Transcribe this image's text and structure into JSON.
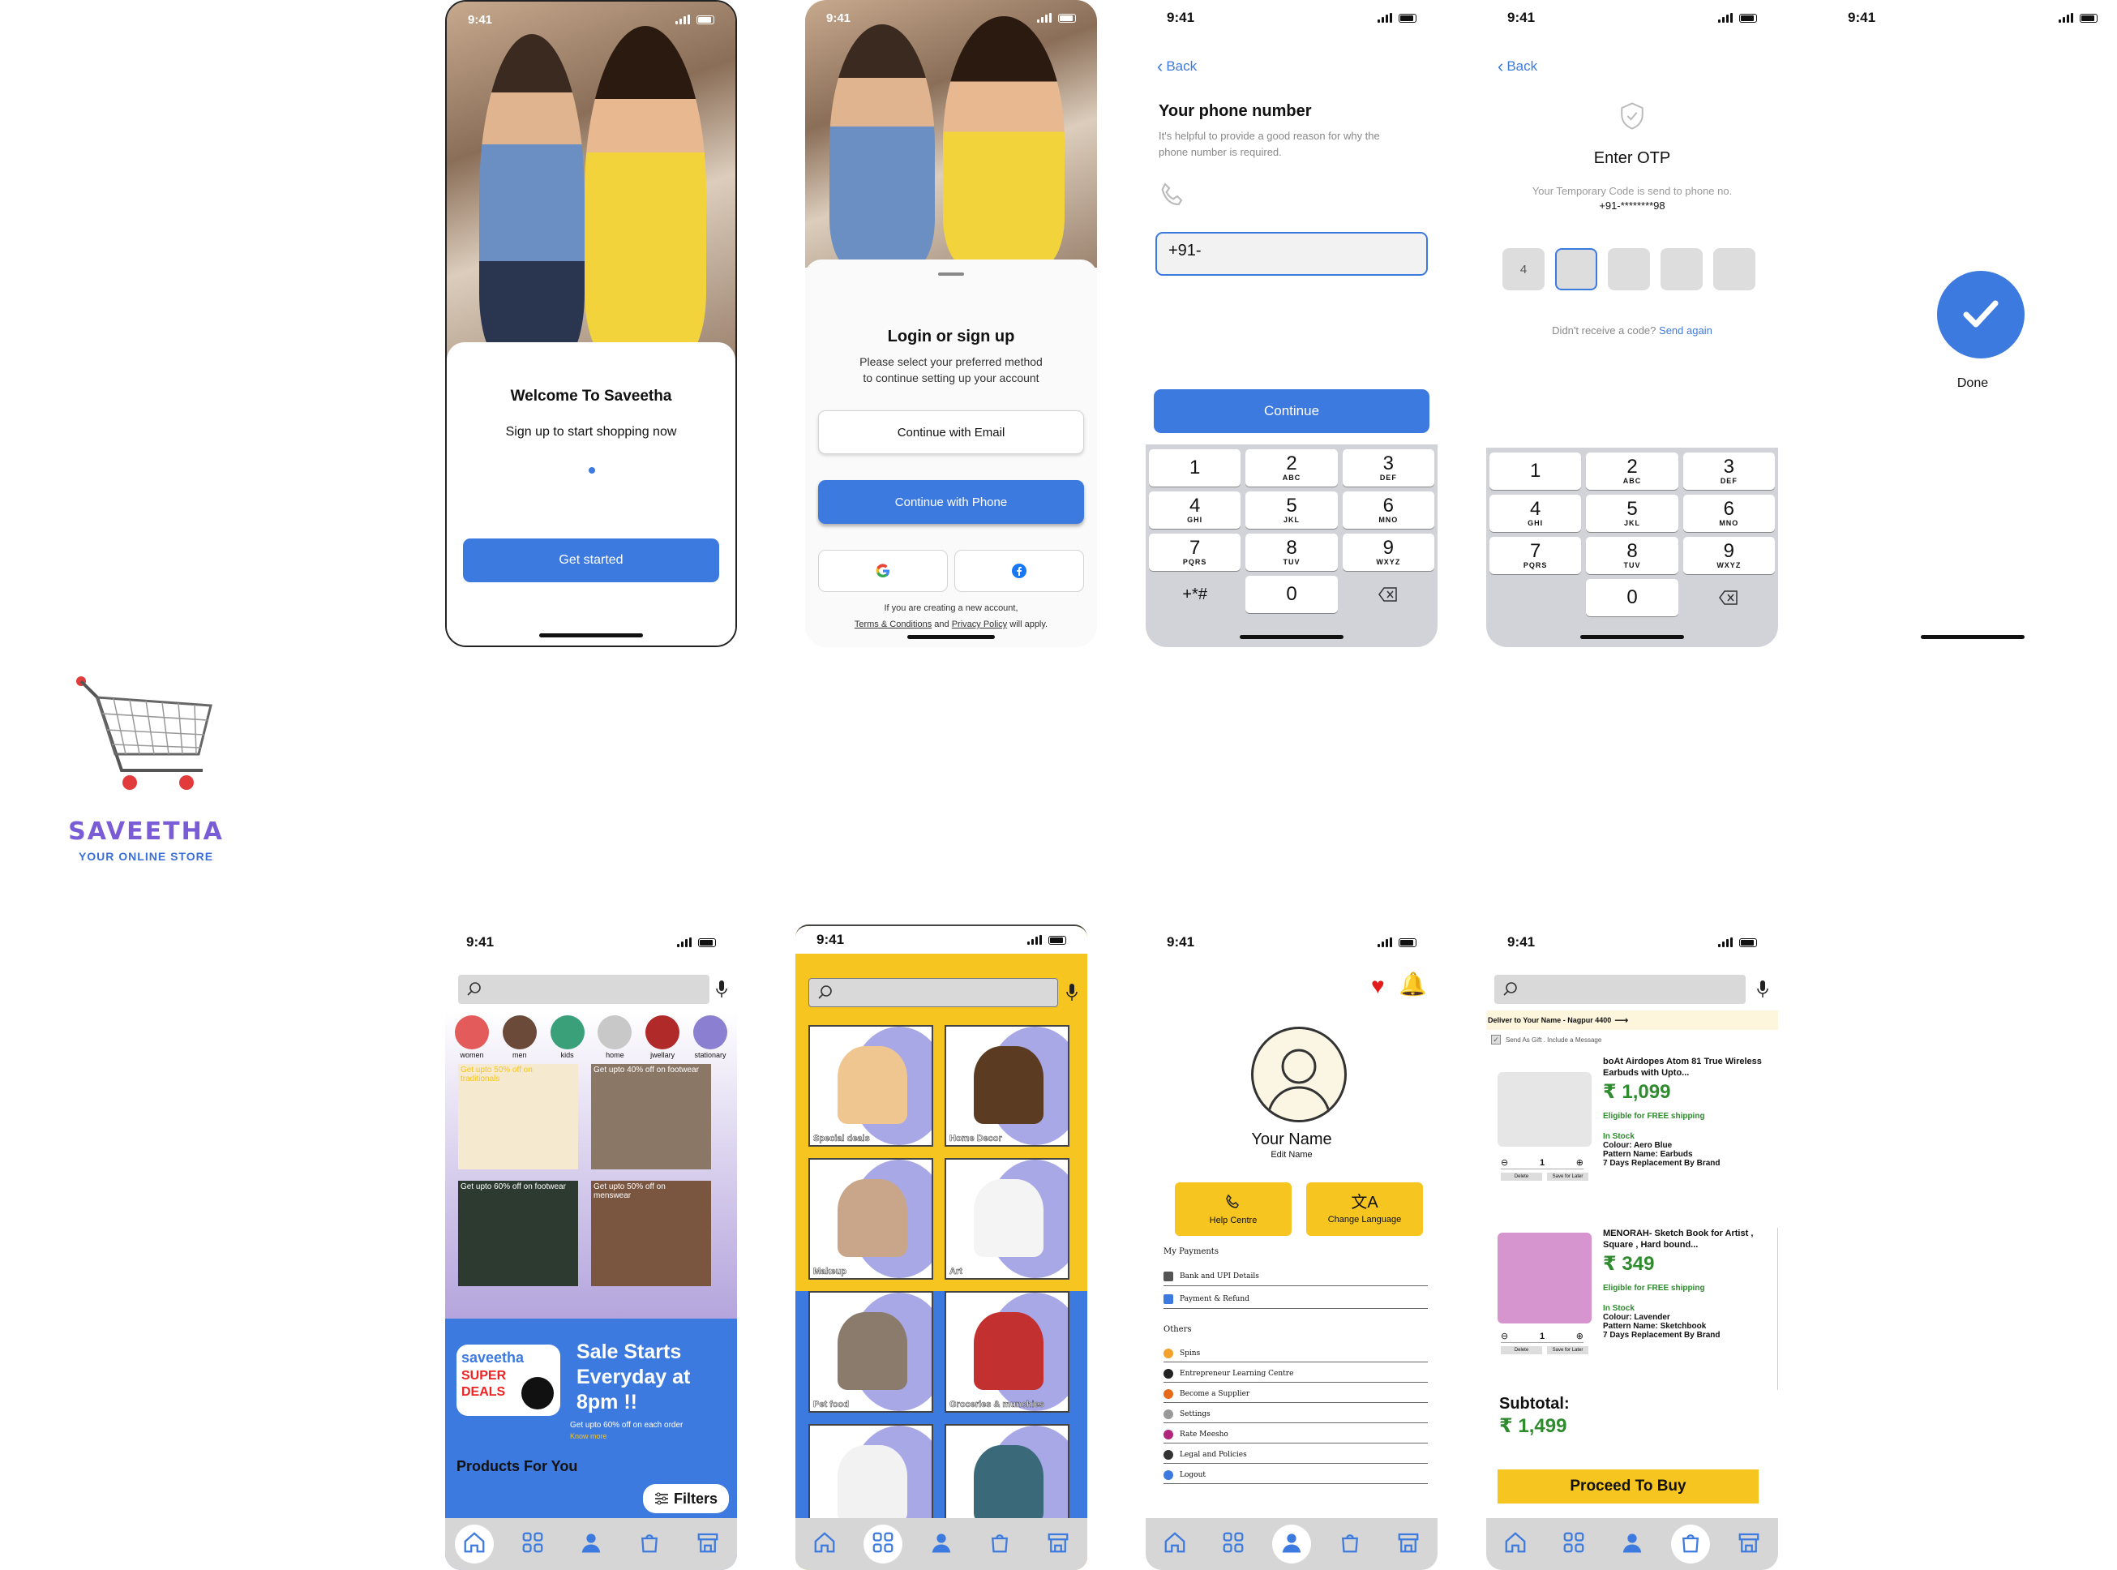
{
  "status_time": "9:41",
  "brand": {
    "name": "SAVEETHA",
    "tagline": "YOUR ONLINE STORE",
    "color": "#7a5cd6"
  },
  "colors": {
    "accent": "#3d7ae0",
    "yellow": "#f7c51f",
    "green": "#2e8b2e"
  },
  "welcome": {
    "title": "Welcome To Saveetha",
    "subtitle": "Sign up to start shopping now",
    "cta": "Get started"
  },
  "login": {
    "title": "Login or sign up",
    "desc_line1": "Please select your preferred method",
    "desc_line2": "to continue setting up your account",
    "email_btn": "Continue with Email",
    "phone_btn": "Continue with Phone",
    "google_icon": "google-icon",
    "facebook_icon": "facebook-icon",
    "footer_line1": "If you are creating a new account,",
    "terms": "Terms & Conditions",
    "and": "and",
    "privacy": "Privacy Policy",
    "will_apply": "will apply."
  },
  "phone": {
    "back": "Back",
    "title": "Your phone number",
    "desc_line1": "It's helpful to provide a good reason for why the",
    "desc_line2": "phone number is required.",
    "prefix": "+91-",
    "continue": "Continue"
  },
  "otp": {
    "back": "Back",
    "title": "Enter OTP",
    "desc": "Your Temporary  Code is send to phone no.",
    "masked_number": "+91-********98",
    "digits": [
      "4",
      "",
      "",
      "",
      ""
    ],
    "not_received": "Didn't receive a code?",
    "resend": "Send again"
  },
  "keypad": {
    "rows": [
      [
        {
          "n": "1",
          "l": ""
        },
        {
          "n": "2",
          "l": "ABC"
        },
        {
          "n": "3",
          "l": "DEF"
        }
      ],
      [
        {
          "n": "4",
          "l": "GHI"
        },
        {
          "n": "5",
          "l": "JKL"
        },
        {
          "n": "6",
          "l": "MNO"
        }
      ],
      [
        {
          "n": "7",
          "l": "PQRS"
        },
        {
          "n": "8",
          "l": "TUV"
        },
        {
          "n": "9",
          "l": "WXYZ"
        }
      ]
    ],
    "zero": "0",
    "symbols": "+*#"
  },
  "done": {
    "label": "Done"
  },
  "home": {
    "categories": [
      "women",
      "men",
      "kids",
      "home",
      "jwellary",
      "stationary"
    ],
    "offers": [
      "Get upto 50% off on traditionals",
      "Get upto 40% off on footwear",
      "Get upto 60% off on footwear",
      "Get upto 50% off on menswear"
    ],
    "banner_brand": "saveetha",
    "banner_super": "SUPER",
    "banner_deals": "DEALS",
    "banner_title": "Sale Starts Everyday at 8pm !!",
    "banner_sub": "Get upto 60% off on each order",
    "banner_link": "Know more",
    "products_title": "Products For You",
    "filters": "Filters"
  },
  "category_grid": {
    "tiles": [
      "Special deals",
      "Home Decor",
      "Makeup",
      "Art",
      "Pet food",
      "Groceries & munchies",
      "",
      ""
    ]
  },
  "profile": {
    "name": "Your Name",
    "edit": "Edit Name",
    "help": "Help Centre",
    "language": "Change Language",
    "payments_header": "My Payments",
    "payments": [
      "Bank and UPI Details",
      "Payment & Refund"
    ],
    "others_header": "Others",
    "others": [
      "Spins",
      "Entrepreneur Learning Centre",
      "Become a Supplier",
      "Settings",
      "Rate Meesho",
      "Legal and Policies",
      "Logout"
    ]
  },
  "cart": {
    "deliver": "Deliver to Your Name - Nagpur 4400",
    "gift": "Send As Gift . Include a Message",
    "items": [
      {
        "title": "boAt Airdopes Atom 81 True Wireless Earbuds with Upto...",
        "price": "₹ 1,099",
        "shipping": "Eligible for FREE shipping",
        "stock": "In Stock",
        "colour": "Colour: Aero Blue",
        "pattern": "Pattern Name: Earbuds",
        "replacement": "7 Days Replacement By Brand",
        "qty": "1",
        "delete": "Delete",
        "save": "Save for Later"
      },
      {
        "title": "MENORAH- Sketch Book for Artist , Square , Hard bound...",
        "price": "₹ 349",
        "shipping": "Eligible for FREE shipping",
        "stock": "In Stock",
        "colour": "Colour: Lavender",
        "pattern": "Pattern Name: Sketchbook",
        "replacement": "7 Days Replacement By Brand",
        "qty": "1",
        "delete": "Delete",
        "save": "Save for Later"
      }
    ],
    "subtotal_label": "Subtotal:",
    "subtotal": "₹ 1,499",
    "proceed": "Proceed To Buy"
  }
}
